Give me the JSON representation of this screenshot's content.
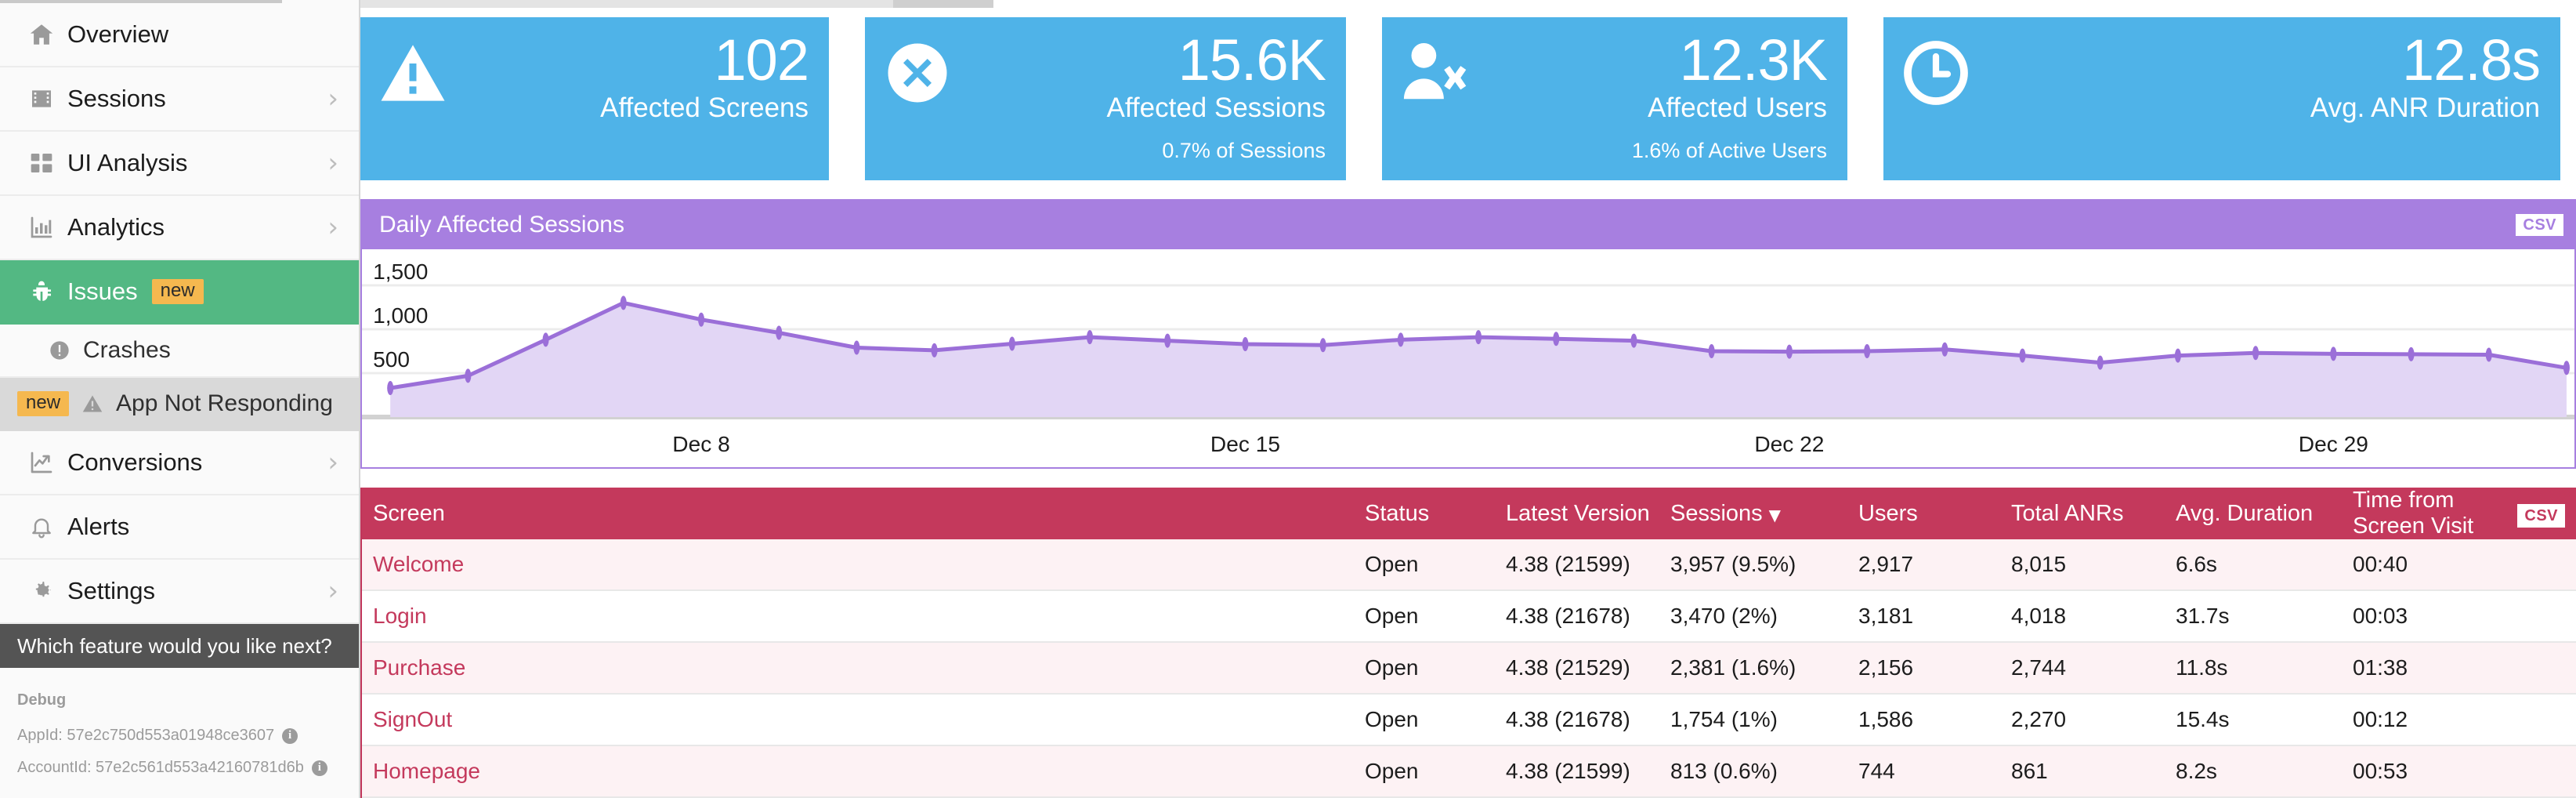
{
  "sidebar": {
    "items": [
      {
        "label": "Overview",
        "icon": "home-icon",
        "chevron": false,
        "badge": null
      },
      {
        "label": "Sessions",
        "icon": "film-icon",
        "chevron": true,
        "badge": null
      },
      {
        "label": "UI Analysis",
        "icon": "grid-icon",
        "chevron": true,
        "badge": null
      },
      {
        "label": "Analytics",
        "icon": "bar-chart-icon",
        "chevron": true,
        "badge": null
      },
      {
        "label": "Issues",
        "icon": "bug-icon",
        "chevron": false,
        "badge": "new",
        "active": true
      }
    ],
    "subitems": [
      {
        "label": "Crashes",
        "icon": "exclamation-circle-icon",
        "badge": null,
        "selected": false
      },
      {
        "label": "App Not Responding",
        "icon": "warning-triangle-icon",
        "badge": "new",
        "selected": true
      }
    ],
    "items_lower": [
      {
        "label": "Conversions",
        "icon": "trend-up-icon",
        "chevron": true
      },
      {
        "label": "Alerts",
        "icon": "bell-icon",
        "chevron": false
      },
      {
        "label": "Settings",
        "icon": "gear-icon",
        "chevron": true
      }
    ],
    "feature_prompt": "Which feature would you like next?",
    "debug": {
      "title": "Debug",
      "app_id": "AppId: 57e2c750d553a01948ce3607",
      "account_id": "AccountId: 57e2c561d553a42160781d6b"
    }
  },
  "cards": [
    {
      "value": "102",
      "label": "Affected Screens",
      "sub": "",
      "icon": "warning-triangle-icon"
    },
    {
      "value": "15.6K",
      "label": "Affected Sessions",
      "sub": "0.7% of Sessions",
      "icon": "x-circle-icon"
    },
    {
      "value": "12.3K",
      "label": "Affected Users",
      "sub": "1.6% of Active Users",
      "icon": "user-x-icon"
    },
    {
      "value": "12.8s",
      "label": "Avg. ANR Duration",
      "sub": "",
      "icon": "clock-icon"
    }
  ],
  "chart_panel": {
    "title": "Daily Affected Sessions",
    "csv_label": "CSV"
  },
  "chart_data": {
    "type": "area",
    "title": "Daily Affected Sessions",
    "xlabel": "",
    "ylabel": "",
    "ylim": [
      0,
      1750
    ],
    "yticks": [
      500,
      1000,
      1500
    ],
    "ytick_labels": [
      "500",
      "1,000",
      "1,500"
    ],
    "xtick_labels": [
      "Dec 8",
      "Dec 15",
      "Dec 22",
      "Dec 29"
    ],
    "xtick_indices": [
      4,
      11,
      18,
      25
    ],
    "grid": true,
    "legend": false,
    "series": [
      {
        "name": "Affected Sessions",
        "color": "#9b6fd8",
        "fill": "#e2d6f5",
        "values": [
          330,
          470,
          880,
          1300,
          1110,
          960,
          790,
          760,
          835,
          910,
          870,
          830,
          820,
          880,
          910,
          890,
          870,
          750,
          745,
          750,
          770,
          700,
          620,
          700,
          730,
          720,
          715,
          710,
          560
        ]
      }
    ]
  },
  "table": {
    "csv_label": "CSV",
    "columns": [
      "Screen",
      "Status",
      "Latest Version",
      "Sessions",
      "Users",
      "Total ANRs",
      "Avg. Duration",
      "Time from Screen Visit"
    ],
    "sorted_column": "Sessions",
    "sort_direction": "desc",
    "rows": [
      {
        "screen": "Welcome",
        "status": "Open",
        "version": "4.38 (21599)",
        "sessions": "3,957 (9.5%)",
        "users": "2,917",
        "anrs": "8,015",
        "duration": "6.6s",
        "time": "00:40"
      },
      {
        "screen": "Login",
        "status": "Open",
        "version": "4.38 (21678)",
        "sessions": "3,470 (2%)",
        "users": "3,181",
        "anrs": "4,018",
        "duration": "31.7s",
        "time": "00:03"
      },
      {
        "screen": "Purchase",
        "status": "Open",
        "version": "4.38 (21529)",
        "sessions": "2,381 (1.6%)",
        "users": "2,156",
        "anrs": "2,744",
        "duration": "11.8s",
        "time": "01:38"
      },
      {
        "screen": "SignOut",
        "status": "Open",
        "version": "4.38 (21678)",
        "sessions": "1,754 (1%)",
        "users": "1,586",
        "anrs": "2,270",
        "duration": "15.4s",
        "time": "00:12"
      },
      {
        "screen": "Homepage",
        "status": "Open",
        "version": "4.38 (21599)",
        "sessions": "813 (0.6%)",
        "users": "744",
        "anrs": "861",
        "duration": "8.2s",
        "time": "00:53"
      }
    ]
  },
  "colors": {
    "accent_blue": "#4fb3e8",
    "accent_purple": "#a77fe0",
    "accent_red": "#c4395c",
    "active_green": "#53b883",
    "badge_orange": "#f5b84f"
  }
}
